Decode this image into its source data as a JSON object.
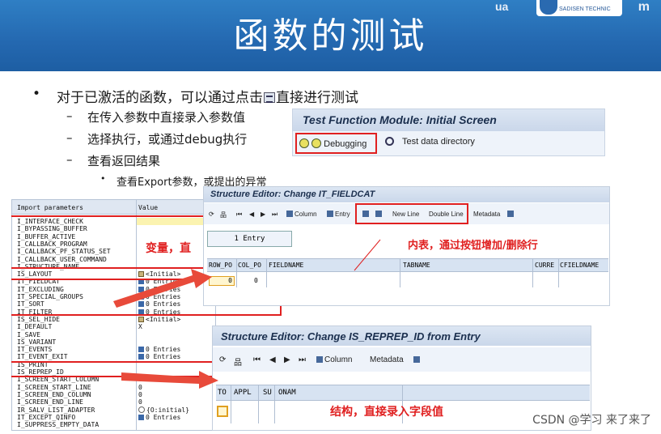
{
  "slide": {
    "title": "函数的测试",
    "logo_text": "SADISEN TECHNIC",
    "logo_head": "ua",
    "logo_tail": "m"
  },
  "bullets": {
    "b1_pre": "对于已激活的函数，可以通过点击",
    "b1_post": "直接进行测试",
    "b2": [
      "在传入参数中直接录入参数值",
      "选择执行，或通过debug执行",
      "查看返回结果"
    ],
    "b3": "查看Export参数，或提出的异常"
  },
  "test_function": {
    "title": "Test Function Module: Initial Screen",
    "debugging_label": "Debugging",
    "test_data_label": "Test data directory"
  },
  "import_panel": {
    "col_name": "Import parameters",
    "col_value": "Value",
    "rows": [
      {
        "name": "I_INTERFACE_CHECK",
        "value": ""
      },
      {
        "name": "I_BYPASSING_BUFFER",
        "value": ""
      },
      {
        "name": "I_BUFFER_ACTIVE",
        "value": ""
      },
      {
        "name": "I_CALLBACK_PROGRAM",
        "value": ""
      },
      {
        "name": "I_CALLBACK_PF_STATUS_SET",
        "value": ""
      },
      {
        "name": "I_CALLBACK_USER_COMMAND",
        "value": ""
      },
      {
        "name": "I_STRUCTURE_NAME",
        "value": ""
      },
      {
        "name": "IS_LAYOUT",
        "value": "<Initial>"
      },
      {
        "name": "IT_FIELDCAT",
        "value": "0 Entries"
      },
      {
        "name": "IT_EXCLUDING",
        "value": "0 Entries"
      },
      {
        "name": "IT_SPECIAL_GROUPS",
        "value": "0 Entries"
      },
      {
        "name": "IT_SORT",
        "value": "0 Entries"
      },
      {
        "name": "IT_FILTER",
        "value": "0 Entries"
      },
      {
        "name": "IS_SEL_HIDE",
        "value": "<Initial>"
      },
      {
        "name": "I_DEFAULT",
        "value": "X"
      },
      {
        "name": "I_SAVE",
        "value": ""
      },
      {
        "name": "IS_VARIANT",
        "value": ""
      },
      {
        "name": "IT_EVENTS",
        "value": "0 Entries"
      },
      {
        "name": "IT_EVENT_EXIT",
        "value": "0 Entries"
      },
      {
        "name": "IS_PRINT",
        "value": ""
      },
      {
        "name": "IS_REPREP_ID",
        "value": ""
      },
      {
        "name": "I_SCREEN_START_COLUMN",
        "value": "0"
      },
      {
        "name": "I_SCREEN_START_LINE",
        "value": "0"
      },
      {
        "name": "I_SCREEN_END_COLUMN",
        "value": "0"
      },
      {
        "name": "I_SCREEN_END_LINE",
        "value": "0"
      },
      {
        "name": "IR_SALV_LIST_ADAPTER",
        "value": "{O:initial}"
      },
      {
        "name": "IT_EXCEPT_QINFO",
        "value": "0 Entries"
      },
      {
        "name": "I_SUPPRESS_EMPTY_DATA",
        "value": ""
      }
    ]
  },
  "se1": {
    "title": "Structure Editor: Change IT_FIELDCAT",
    "column_btn": "Column",
    "entry_btn": "Entry",
    "new_line": "New Line",
    "double_line": "Double Line",
    "metadata": "Metadata",
    "entry_count": "1 Entry",
    "headers": [
      "ROW_PO",
      "COL_PO",
      "FIELDNAME",
      "TABNAME",
      "CURRE",
      "CFIELDNAME"
    ],
    "row": [
      "0",
      "0"
    ]
  },
  "se2": {
    "title": "Structure Editor: Change IS_REPREP_ID from Entry",
    "column_btn": "Column",
    "metadata": "Metadata",
    "headers": [
      "TO",
      "APPL",
      "SU",
      "ONAM"
    ]
  },
  "annotations": {
    "var": "变量，直",
    "table": "内表，通过按钮增加/删除行",
    "struct": "结构，直接录入字段值"
  },
  "watermark": "CSDN @学习 来了来了",
  "colors": {
    "accent_red": "#e02020",
    "header_blue": "#2468b0"
  }
}
